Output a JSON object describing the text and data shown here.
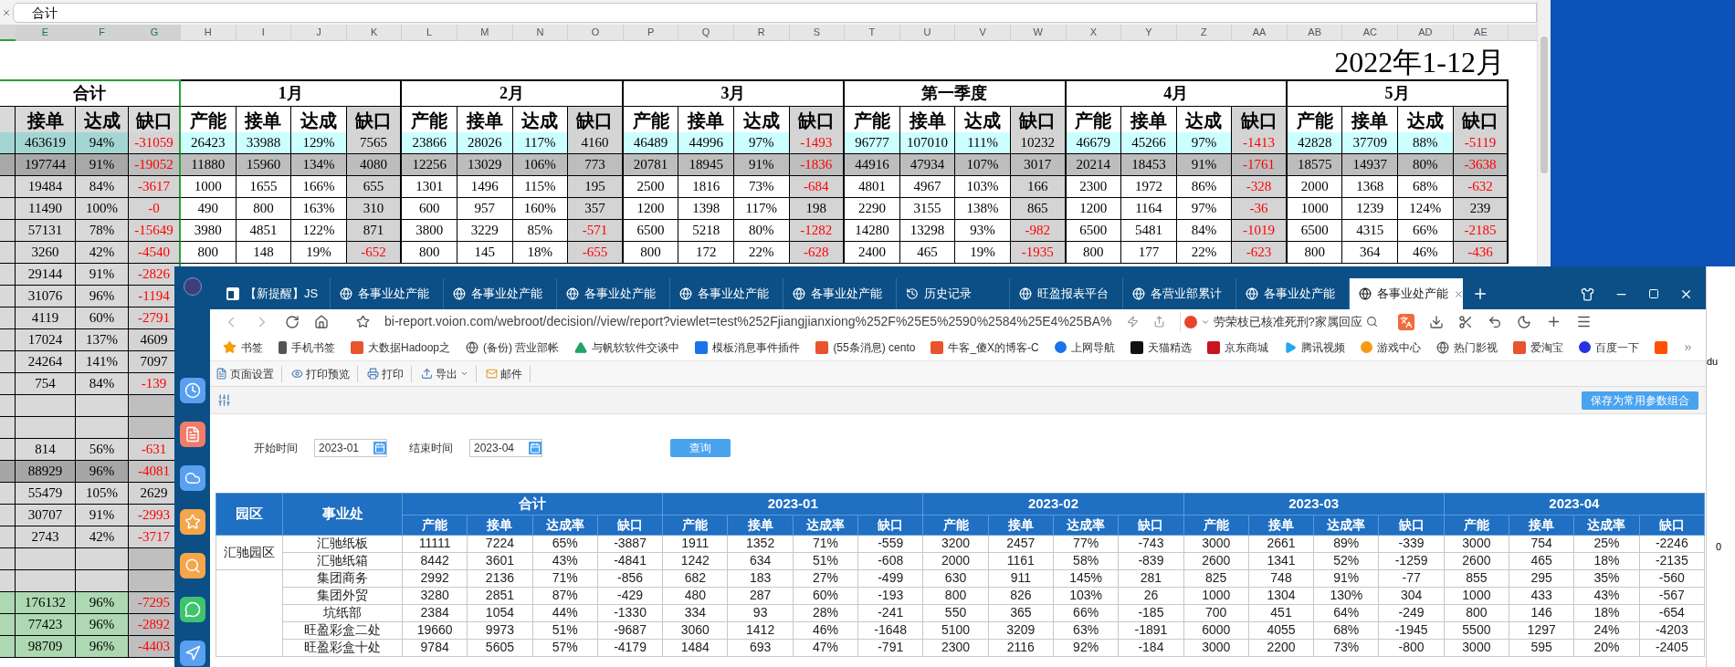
{
  "excel": {
    "formula_bar": {
      "value": "合计"
    },
    "columns": [
      {
        "label": "E",
        "selected": true
      },
      {
        "label": "F",
        "selected": true
      },
      {
        "label": "G",
        "selected": true
      },
      {
        "label": "H",
        "selected": false
      },
      {
        "label": "I",
        "selected": false
      },
      {
        "label": "J",
        "selected": false
      },
      {
        "label": "K",
        "selected": false
      },
      {
        "label": "L",
        "selected": false
      },
      {
        "label": "M",
        "selected": false
      },
      {
        "label": "N",
        "selected": false
      },
      {
        "label": "O",
        "selected": false
      },
      {
        "label": "P",
        "selected": false
      },
      {
        "label": "Q",
        "selected": false
      },
      {
        "label": "R",
        "selected": false
      },
      {
        "label": "S",
        "selected": false
      },
      {
        "label": "T",
        "selected": false
      },
      {
        "label": "U",
        "selected": false
      },
      {
        "label": "V",
        "selected": false
      },
      {
        "label": "W",
        "selected": false
      },
      {
        "label": "X",
        "selected": false
      },
      {
        "label": "Y",
        "selected": false
      },
      {
        "label": "Z",
        "selected": false
      },
      {
        "label": "AA",
        "selected": false
      },
      {
        "label": "AB",
        "selected": false
      },
      {
        "label": "AC",
        "selected": false
      },
      {
        "label": "AD",
        "selected": false
      },
      {
        "label": "AE",
        "selected": false
      }
    ],
    "title": "2022年1-12月",
    "groups": [
      {
        "label": "合计",
        "subheaders": [
          "接单",
          "达成",
          "缺口"
        ]
      },
      {
        "label": "1月",
        "subheaders": [
          "产能",
          "接单",
          "达成",
          "缺口"
        ]
      },
      {
        "label": "2月",
        "subheaders": [
          "产能",
          "接单",
          "达成",
          "缺口"
        ]
      },
      {
        "label": "3月",
        "subheaders": [
          "产能",
          "接单",
          "达成",
          "缺口"
        ]
      },
      {
        "label": "第一季度",
        "subheaders": [
          "产能",
          "接单",
          "达成",
          "缺口"
        ]
      },
      {
        "label": "4月",
        "subheaders": [
          "产能",
          "接单",
          "达成",
          "缺口"
        ]
      },
      {
        "label": "5月",
        "subheaders": [
          "产能",
          "接单",
          "达成",
          "缺口"
        ]
      }
    ],
    "rows": [
      {
        "kind": "summary",
        "cells": [
          "463619",
          "94%",
          {
            "text": "-31059",
            "color": "#ff0000"
          },
          "26423",
          "33988",
          "129%",
          "7565",
          "23866",
          "28026",
          "117%",
          "4160",
          "46489",
          "44996",
          "97%",
          {
            "text": "-1493",
            "color": "#ff0000"
          },
          "96777",
          "107010",
          "111%",
          "10232",
          "46679",
          "45266",
          "97%",
          {
            "text": "-1413",
            "color": "#ff0000"
          },
          "42828",
          "37709",
          "88%",
          {
            "text": "-5119",
            "color": "#ff0000"
          }
        ]
      },
      {
        "kind": "subtotal",
        "cells": [
          "197744",
          "91%",
          {
            "text": "-19052",
            "color": "#ff0000"
          },
          "11880",
          "15960",
          "134%",
          "4080",
          "12256",
          "13029",
          "106%",
          "773",
          "20781",
          "18945",
          "91%",
          {
            "text": "-1836",
            "color": "#ff0000"
          },
          "44916",
          "47934",
          "107%",
          "3017",
          "20214",
          "18453",
          "91%",
          {
            "text": "-1761",
            "color": "#ff0000"
          },
          "18575",
          "14937",
          "80%",
          {
            "text": "-3638",
            "color": "#ff0000"
          }
        ]
      },
      {
        "kind": "normal",
        "cells": [
          "19484",
          "84%",
          {
            "text": "-3617",
            "color": "#ff0000"
          },
          "1000",
          "1655",
          "166%",
          "655",
          "1301",
          "1496",
          "115%",
          "195",
          "2500",
          "1816",
          "73%",
          {
            "text": "-684",
            "color": "#ff0000"
          },
          "4801",
          "4967",
          "103%",
          "166",
          "2300",
          "1972",
          "86%",
          {
            "text": "-328",
            "color": "#ff0000"
          },
          "2000",
          "1368",
          "68%",
          {
            "text": "-632",
            "color": "#ff0000"
          }
        ]
      },
      {
        "kind": "normal",
        "cells": [
          "11490",
          "100%",
          {
            "text": "-0",
            "color": "#ff0000"
          },
          "490",
          "800",
          "163%",
          "310",
          "600",
          "957",
          "160%",
          "357",
          "1200",
          "1398",
          "117%",
          "198",
          "2290",
          "3155",
          "138%",
          "865",
          "1200",
          "1164",
          "97%",
          {
            "text": "-36",
            "color": "#ff0000"
          },
          "1000",
          "1239",
          "124%",
          "239"
        ]
      },
      {
        "kind": "normal",
        "cells": [
          "57131",
          "78%",
          {
            "text": "-15649",
            "color": "#ff0000"
          },
          "3980",
          "4851",
          "122%",
          "871",
          "3800",
          "3229",
          "85%",
          {
            "text": "-571",
            "color": "#ff0000"
          },
          "6500",
          "5218",
          "80%",
          {
            "text": "-1282",
            "color": "#ff0000"
          },
          "14280",
          "13298",
          "93%",
          {
            "text": "-982",
            "color": "#ff0000"
          },
          "6500",
          "5481",
          "84%",
          {
            "text": "-1019",
            "color": "#ff0000"
          },
          "6500",
          "4315",
          "66%",
          {
            "text": "-2185",
            "color": "#ff0000"
          }
        ]
      },
      {
        "kind": "normal",
        "cells": [
          "3260",
          "42%",
          {
            "text": "-4540",
            "color": "#ff0000"
          },
          "800",
          "148",
          "19%",
          {
            "text": "-652",
            "color": "#ff0000"
          },
          "800",
          "145",
          "18%",
          {
            "text": "-655",
            "color": "#ff0000"
          },
          "800",
          "172",
          "22%",
          {
            "text": "-628",
            "color": "#ff0000"
          },
          "2400",
          "465",
          "19%",
          {
            "text": "-1935",
            "color": "#ff0000"
          },
          "800",
          "177",
          "22%",
          {
            "text": "-623",
            "color": "#ff0000"
          },
          "800",
          "364",
          "46%",
          {
            "text": "-436",
            "color": "#ff0000"
          }
        ]
      },
      {
        "kind": "normal",
        "cells": [
          "29144",
          "91%",
          {
            "text": "-2826",
            "color": "#ff0000"
          }
        ]
      },
      {
        "kind": "normal",
        "cells": [
          "31076",
          "96%",
          {
            "text": "-1194",
            "color": "#ff0000"
          }
        ]
      },
      {
        "kind": "normal",
        "cells": [
          "4119",
          "60%",
          {
            "text": "-2791",
            "color": "#ff0000"
          }
        ]
      },
      {
        "kind": "normal",
        "cells": [
          "17024",
          "137%",
          "4609"
        ]
      },
      {
        "kind": "normal",
        "cells": [
          "24264",
          "141%",
          "7097"
        ]
      },
      {
        "kind": "normal",
        "cells": [
          "754",
          "84%",
          {
            "text": "-139",
            "color": "#ff0000"
          }
        ]
      },
      {
        "kind": "empty"
      },
      {
        "kind": "empty"
      },
      {
        "kind": "normal",
        "cells": [
          "814",
          "56%",
          {
            "text": "-631",
            "color": "#ff0000"
          }
        ]
      },
      {
        "kind": "dark",
        "cells": [
          "88929",
          "96%",
          {
            "text": "-4081",
            "color": "#ff0000"
          }
        ]
      },
      {
        "kind": "normal",
        "cells": [
          "55479",
          "105%",
          "2629"
        ]
      },
      {
        "kind": "normal",
        "cells": [
          "30707",
          "91%",
          {
            "text": "-2993",
            "color": "#ff0000"
          }
        ]
      },
      {
        "kind": "normal",
        "cells": [
          "2743",
          "42%",
          {
            "text": "-3717",
            "color": "#ff0000"
          }
        ]
      },
      {
        "kind": "empty"
      },
      {
        "kind": "empty"
      },
      {
        "kind": "group",
        "cells": [
          "176132",
          "96%",
          {
            "text": "-7295",
            "color": "#ff0000"
          }
        ]
      },
      {
        "kind": "group",
        "cells": [
          "77423",
          "96%",
          {
            "text": "-2892",
            "color": "#ff0000"
          }
        ]
      },
      {
        "kind": "group",
        "cells": [
          "98709",
          "96%",
          {
            "text": "-4403",
            "color": "#ff0000"
          }
        ]
      }
    ]
  },
  "browser": {
    "tabs": [
      {
        "label": "【新提醒】JS",
        "kind": "logo",
        "selected": false
      },
      {
        "label": "各事业处产能",
        "kind": "globe",
        "selected": false
      },
      {
        "label": "各事业处产能",
        "kind": "globe",
        "selected": false
      },
      {
        "label": "各事业处产能",
        "kind": "globe",
        "selected": false
      },
      {
        "label": "各事业处产能",
        "kind": "globe",
        "selected": false
      },
      {
        "label": "各事业处产能",
        "kind": "globe",
        "selected": false
      },
      {
        "label": "历史记录",
        "kind": "history",
        "selected": false
      },
      {
        "label": "旺盈报表平台",
        "kind": "globe",
        "selected": false
      },
      {
        "label": "各营业部累计",
        "kind": "globe",
        "selected": false
      },
      {
        "label": "各事业处产能",
        "kind": "globe",
        "selected": false
      },
      {
        "label": "各事业处产能",
        "kind": "globe",
        "selected": true
      }
    ],
    "address": {
      "url": "bi-report.voion.com/webroot/decision//view/report?viewlet=test%252Fjiangjianxiong%252F%25E5%2590%2584%25E4%25BA%"
    },
    "search": {
      "value": "劳荣枝已核准死刑?家属回应"
    },
    "bookmarks": [
      {
        "label": "书签",
        "kind": "star",
        "color": "#f5a000"
      },
      {
        "label": "手机书签",
        "kind": "phone",
        "color": "#555555"
      },
      {
        "label": "大数据Hadoop之",
        "kind": "tile",
        "color": "#e8542c"
      },
      {
        "label": "(备份) 营业部帐",
        "kind": "globe",
        "color": "#555555"
      },
      {
        "label": "与帆软软件交谈中",
        "kind": "triangle",
        "color": "#1fa463"
      },
      {
        "label": "模板消息事件插件",
        "kind": "tile",
        "color": "#1a73e8"
      },
      {
        "label": "(55条消息) cento",
        "kind": "tile",
        "color": "#e8542c"
      },
      {
        "label": "牛客_傻X的博客-C",
        "kind": "tile",
        "color": "#e8542c"
      },
      {
        "label": "上网导航",
        "kind": "circle",
        "color": "#1a73e8"
      },
      {
        "label": "天猫精选",
        "kind": "tile",
        "color": "#111111"
      },
      {
        "label": "京东商城",
        "kind": "tile",
        "color": "#c9151e"
      },
      {
        "label": "腾讯视频",
        "kind": "play",
        "color": "#22a7f0"
      },
      {
        "label": "游戏中心",
        "kind": "circle",
        "color": "#f39c12"
      },
      {
        "label": "热门影视",
        "kind": "globe",
        "color": "#555555"
      },
      {
        "label": "爱淘宝",
        "kind": "tile",
        "color": "#e8542c"
      },
      {
        "label": "百度一下",
        "kind": "circle",
        "color": "#2932e1"
      },
      {
        "kind": "tile",
        "color": "#ff5000"
      }
    ],
    "report_toolbar": [
      {
        "label": "页面设置",
        "kind": "page"
      },
      {
        "label": "打印预览",
        "kind": "preview"
      },
      {
        "label": "打印",
        "kind": "print"
      },
      {
        "label": "导出",
        "kind": "export"
      },
      {
        "label": "邮件",
        "kind": "mail"
      }
    ],
    "params": {
      "save_button": "保存为常用参数组合",
      "fields": [
        {
          "label": "开始时间",
          "value": "2023-01"
        },
        {
          "label": "结束时间",
          "value": "2023-04"
        }
      ],
      "query_button": "查询"
    },
    "table": {
      "fixed_columns": [
        "园区",
        "事业处"
      ],
      "groups": [
        {
          "label": "合计",
          "columns": [
            "产能",
            "接单",
            "达成率",
            "缺口"
          ]
        },
        {
          "label": "2023-01",
          "columns": [
            "产能",
            "接单",
            "达成率",
            "缺口"
          ]
        },
        {
          "label": "2023-02",
          "columns": [
            "产能",
            "接单",
            "达成率",
            "缺口"
          ]
        },
        {
          "label": "2023-03",
          "columns": [
            "产能",
            "接单",
            "达成率",
            "缺口"
          ]
        },
        {
          "label": "2023-04",
          "columns": [
            "产能",
            "接单",
            "达成率",
            "缺口"
          ]
        }
      ],
      "parks": [
        {
          "park": "汇驰园区",
          "rows": [
            {
              "name": "汇驰纸板",
              "values": [
                "11111",
                "7224",
                "65%",
                "-3887",
                "1911",
                "1352",
                "71%",
                "-559",
                "3200",
                "2457",
                "77%",
                "-743",
                "3000",
                "2661",
                "89%",
                "-339",
                "3000",
                "754",
                "25%",
                "-2246"
              ]
            },
            {
              "name": "汇驰纸箱",
              "values": [
                "8442",
                "3601",
                "43%",
                "-4841",
                "1242",
                "634",
                "51%",
                "-608",
                "2000",
                "1161",
                "58%",
                "-839",
                "2600",
                "1341",
                "52%",
                "-1259",
                "2600",
                "465",
                "18%",
                "-2135"
              ]
            }
          ]
        },
        {
          "rows": [
            {
              "name": "集团商务",
              "values": [
                "2992",
                "2136",
                "71%",
                "-856",
                "682",
                "183",
                "27%",
                "-499",
                "630",
                "911",
                "145%",
                "281",
                "825",
                "748",
                "91%",
                "-77",
                "855",
                "295",
                "35%",
                "-560"
              ]
            },
            {
              "name": "集团外贸",
              "values": [
                "3280",
                "2851",
                "87%",
                "-429",
                "480",
                "287",
                "60%",
                "-193",
                "800",
                "826",
                "103%",
                "26",
                "1000",
                "1304",
                "130%",
                "304",
                "1000",
                "433",
                "43%",
                "-567"
              ]
            },
            {
              "name": "坑纸部",
              "values": [
                "2384",
                "1054",
                "44%",
                "-1330",
                "334",
                "93",
                "28%",
                "-241",
                "550",
                "365",
                "66%",
                "-185",
                "700",
                "451",
                "64%",
                "-249",
                "800",
                "146",
                "18%",
                "-654"
              ]
            },
            {
              "name": "旺盈彩盒二处",
              "values": [
                "19660",
                "9973",
                "51%",
                "-9687",
                "3060",
                "1412",
                "46%",
                "-1648",
                "5100",
                "3209",
                "63%",
                "-1891",
                "6000",
                "4055",
                "68%",
                "-1945",
                "5500",
                "1297",
                "24%",
                "-4203"
              ]
            },
            {
              "name": "旺盈彩盒十处",
              "values": [
                "9784",
                "5605",
                "57%",
                "-4179",
                "1484",
                "693",
                "47%",
                "-791",
                "2300",
                "2116",
                "92%",
                "-184",
                "3000",
                "2200",
                "73%",
                "-800",
                "3000",
                "595",
                "20%",
                "-2405"
              ]
            }
          ]
        }
      ]
    }
  },
  "background_window": {
    "texts": [
      "du",
      "0"
    ]
  }
}
